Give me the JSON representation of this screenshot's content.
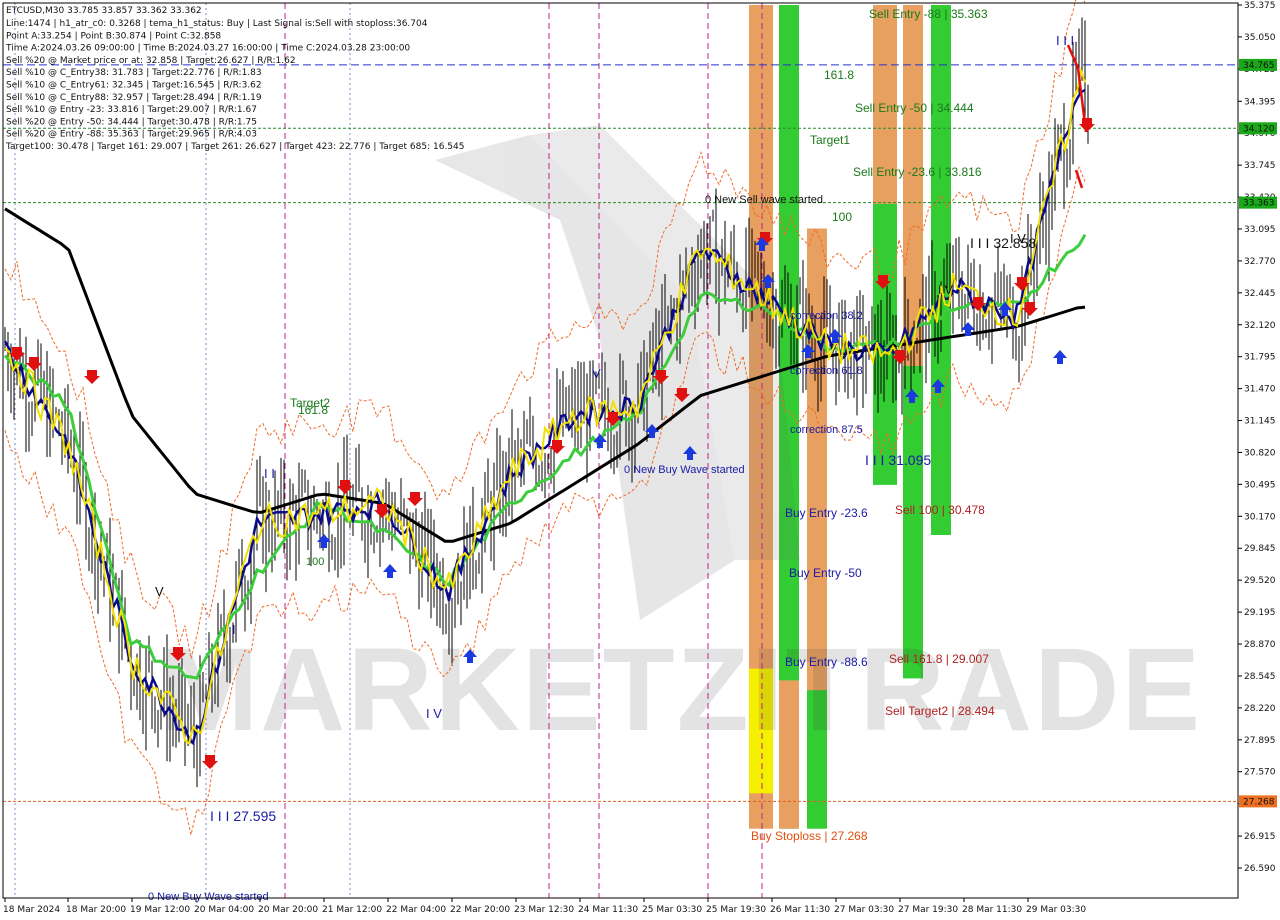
{
  "symbol_line": "ETCUSD,M30  33.785 33.857 33.362 33.362",
  "info_lines": [
    "Line:1474  |  h1_atr_c0: 0.3268  |  tema_h1_status: Buy  |  Last Signal is:Sell with stoploss:36.704",
    "Point A:33.254  |  Point B:30.874  |  Point C:32.858",
    "Time A:2024.03.26 09:00:00  |  Time B:2024.03.27 16:00:00  |  Time C:2024.03.28 23:00:00",
    "Sell %20 @ Market price or at: 32.858  |  Target:26.627  |  R/R:1.62",
    "Sell %10 @ C_Entry38: 31.783  |  Target:22.776  |  R/R:1.83",
    "Sell %10 @ C_Entry61: 32.345  |  Target:16.545  |  R/R:3.62",
    "Sell %10 @ C_Entry88: 32.957  |  Target:28.494  |  R/R:1.19",
    "Sell %10 @ Entry -23: 33.816  |  Target:29.007  |  R/R:1.67",
    "Sell %20 @ Entry -50: 34.444  |  Target:30.478  |  R/R:1.75",
    "Sell %20 @ Entry -88: 35.363  |  Target:29.965  |  R/R:4.03",
    "Target100: 30.478  |  Target 161: 29.007  |  Target 261: 26.627  |  Target 423: 22.776  |  Target 685: 16.545"
  ],
  "price_ticks": [
    "35.375",
    "35.050",
    "34.725",
    "34.395",
    "34.070",
    "33.745",
    "33.420",
    "33.095",
    "32.770",
    "32.445",
    "32.120",
    "31.795",
    "31.470",
    "31.145",
    "30.820",
    "30.495",
    "30.170",
    "29.845",
    "29.520",
    "29.195",
    "28.870",
    "28.545",
    "28.220",
    "27.895",
    "27.570",
    "27.245",
    "26.915",
    "26.590"
  ],
  "time_ticks": [
    "18 Mar 2024",
    "18 Mar 20:00",
    "19 Mar 12:00",
    "20 Mar 04:00",
    "20 Mar 20:00",
    "21 Mar 12:00",
    "22 Mar 04:00",
    "22 Mar 20:00",
    "23 Mar 12:30",
    "24 Mar 11:30",
    "25 Mar 03:30",
    "25 Mar 19:30",
    "26 Mar 11:30",
    "27 Mar 03:30",
    "27 Mar 19:30",
    "28 Mar 11:30",
    "29 Mar 03:30"
  ],
  "price_tags": [
    {
      "value": "34.765",
      "bg": "#18a818"
    },
    {
      "value": "34.120",
      "bg": "#18a818"
    },
    {
      "value": "33.363",
      "bg": "#18a818"
    },
    {
      "value": "27.268",
      "bg": "#f07020"
    }
  ],
  "levels": [
    {
      "label": "Sell Entry -88 | 35.363",
      "color": "#1a7a1a"
    },
    {
      "label": "161.8",
      "color": "#1a7a1a"
    },
    {
      "label": "Sell Entry -50 | 34.444",
      "color": "#1a7a1a"
    },
    {
      "label": "Target1",
      "color": "#1a7a1a"
    },
    {
      "label": "Sell Entry -23.6 | 33.816",
      "color": "#1a7a1a"
    },
    {
      "label": "0 New Sell wave started",
      "color": "#111111"
    },
    {
      "label": "100",
      "color": "#1a7a1a"
    },
    {
      "label": "I I I 32.858",
      "color": "#111111"
    },
    {
      "label": "Target2",
      "color": "#1a7a1a"
    },
    {
      "label": "161.8",
      "color": "#1a7a1a"
    },
    {
      "label": "I V",
      "color": "#111111"
    },
    {
      "label": "correction 38.2",
      "color": "#1a1aa8"
    },
    {
      "label": "correction 61.8",
      "color": "#1a1aa8"
    },
    {
      "label": "correction 87.5",
      "color": "#1a1aa8"
    },
    {
      "label": "I I I 31.095",
      "color": "#1a1aa8"
    },
    {
      "label": "0 New Buy Wave started",
      "color": "#1a1aa8"
    },
    {
      "label": "Buy Entry -23.6",
      "color": "#1a1aa8"
    },
    {
      "label": "Sell 100 | 30.478",
      "color": "#b02020"
    },
    {
      "label": "Buy Entry -50",
      "color": "#1a1aa8"
    },
    {
      "label": "Buy Entry -88.6",
      "color": "#1a1aa8"
    },
    {
      "label": "Sell 161.8 | 29.007",
      "color": "#b02020"
    },
    {
      "label": "Sell Target2 | 28.494",
      "color": "#b02020"
    },
    {
      "label": "Buy Stoploss | 27.268",
      "color": "#e05010"
    },
    {
      "label": "I I I 27.595",
      "color": "#1a1aa8"
    },
    {
      "label": "0 New Buy Wave started",
      "color": "#1a1aa8"
    },
    {
      "label": "I V",
      "color": "#1a1aa8"
    },
    {
      "label": "I I",
      "color": "#1a1aa8"
    },
    {
      "label": "I",
      "color": "#1a1aa8"
    },
    {
      "label": "V",
      "color": "#111111"
    },
    {
      "label": "V",
      "color": "#1a1aa8"
    },
    {
      "label": "100",
      "color": "#1a7a1a"
    },
    {
      "label": "I I I",
      "color": "#1a1aa8"
    },
    {
      "label": "I V",
      "color": "#111111"
    }
  ],
  "watermark": "MARKETZITRADE",
  "chart_data": {
    "type": "line",
    "title": "ETCUSD,M30",
    "ylim": [
      26.59,
      35.375
    ],
    "x": [
      "18 Mar 2024",
      "18 Mar 20:00",
      "19 Mar 12:00",
      "20 Mar 04:00",
      "20 Mar 20:00",
      "21 Mar 12:00",
      "22 Mar 04:00",
      "22 Mar 20:00",
      "23 Mar 12:30",
      "24 Mar 11:30",
      "25 Mar 03:30",
      "25 Mar 19:30",
      "26 Mar 11:30",
      "27 Mar 03:30",
      "27 Mar 19:30",
      "28 Mar 11:30",
      "29 Mar 03:30"
    ],
    "series": [
      {
        "values": [
          31.9,
          30.9,
          28.7,
          27.9,
          30.1,
          30.2,
          30.3,
          29.4,
          30.6,
          31.2,
          31.3,
          32.9,
          32.4,
          31.9,
          31.8,
          32.5,
          32.2,
          34.6
        ]
      },
      {
        "values": [
          33.3,
          32.9,
          31.2,
          30.4,
          30.2,
          30.4,
          30.3,
          29.9,
          30.1,
          30.5,
          30.9,
          31.4,
          31.6,
          31.8,
          31.9,
          32.0,
          32.1,
          32.3
        ]
      },
      {
        "values": [
          31.8,
          31.3,
          28.9,
          28.5,
          29.6,
          30.3,
          30.0,
          29.5,
          30.3,
          30.8,
          31.2,
          32.4,
          32.3,
          31.9,
          31.9,
          32.3,
          32.3,
          33.0
        ]
      }
    ],
    "zones": [
      {
        "low": 26.99,
        "high": 35.375,
        "color": "#e8a060"
      },
      {
        "low": 27.35,
        "high": 28.62,
        "color": "#f5f000"
      },
      {
        "low": 26.99,
        "high": 35.375,
        "color": "#33cc33"
      },
      {
        "low": 26.99,
        "high": 28.5,
        "color": "#e8a060"
      },
      {
        "low": 26.99,
        "high": 33.1,
        "color": "#33cc33"
      },
      {
        "low": 28.4,
        "high": 33.1,
        "color": "#e8a060"
      },
      {
        "low": 30.49,
        "high": 35.375,
        "color": "#33cc33"
      },
      {
        "low": 33.35,
        "high": 35.375,
        "color": "#e8a060"
      },
      {
        "low": 28.52,
        "high": 33.0,
        "color": "#33cc33"
      },
      {
        "low": 31.7,
        "high": 35.375,
        "color": "#e8a060"
      },
      {
        "low": 29.98,
        "high": 35.375,
        "color": "#33cc33"
      }
    ]
  }
}
